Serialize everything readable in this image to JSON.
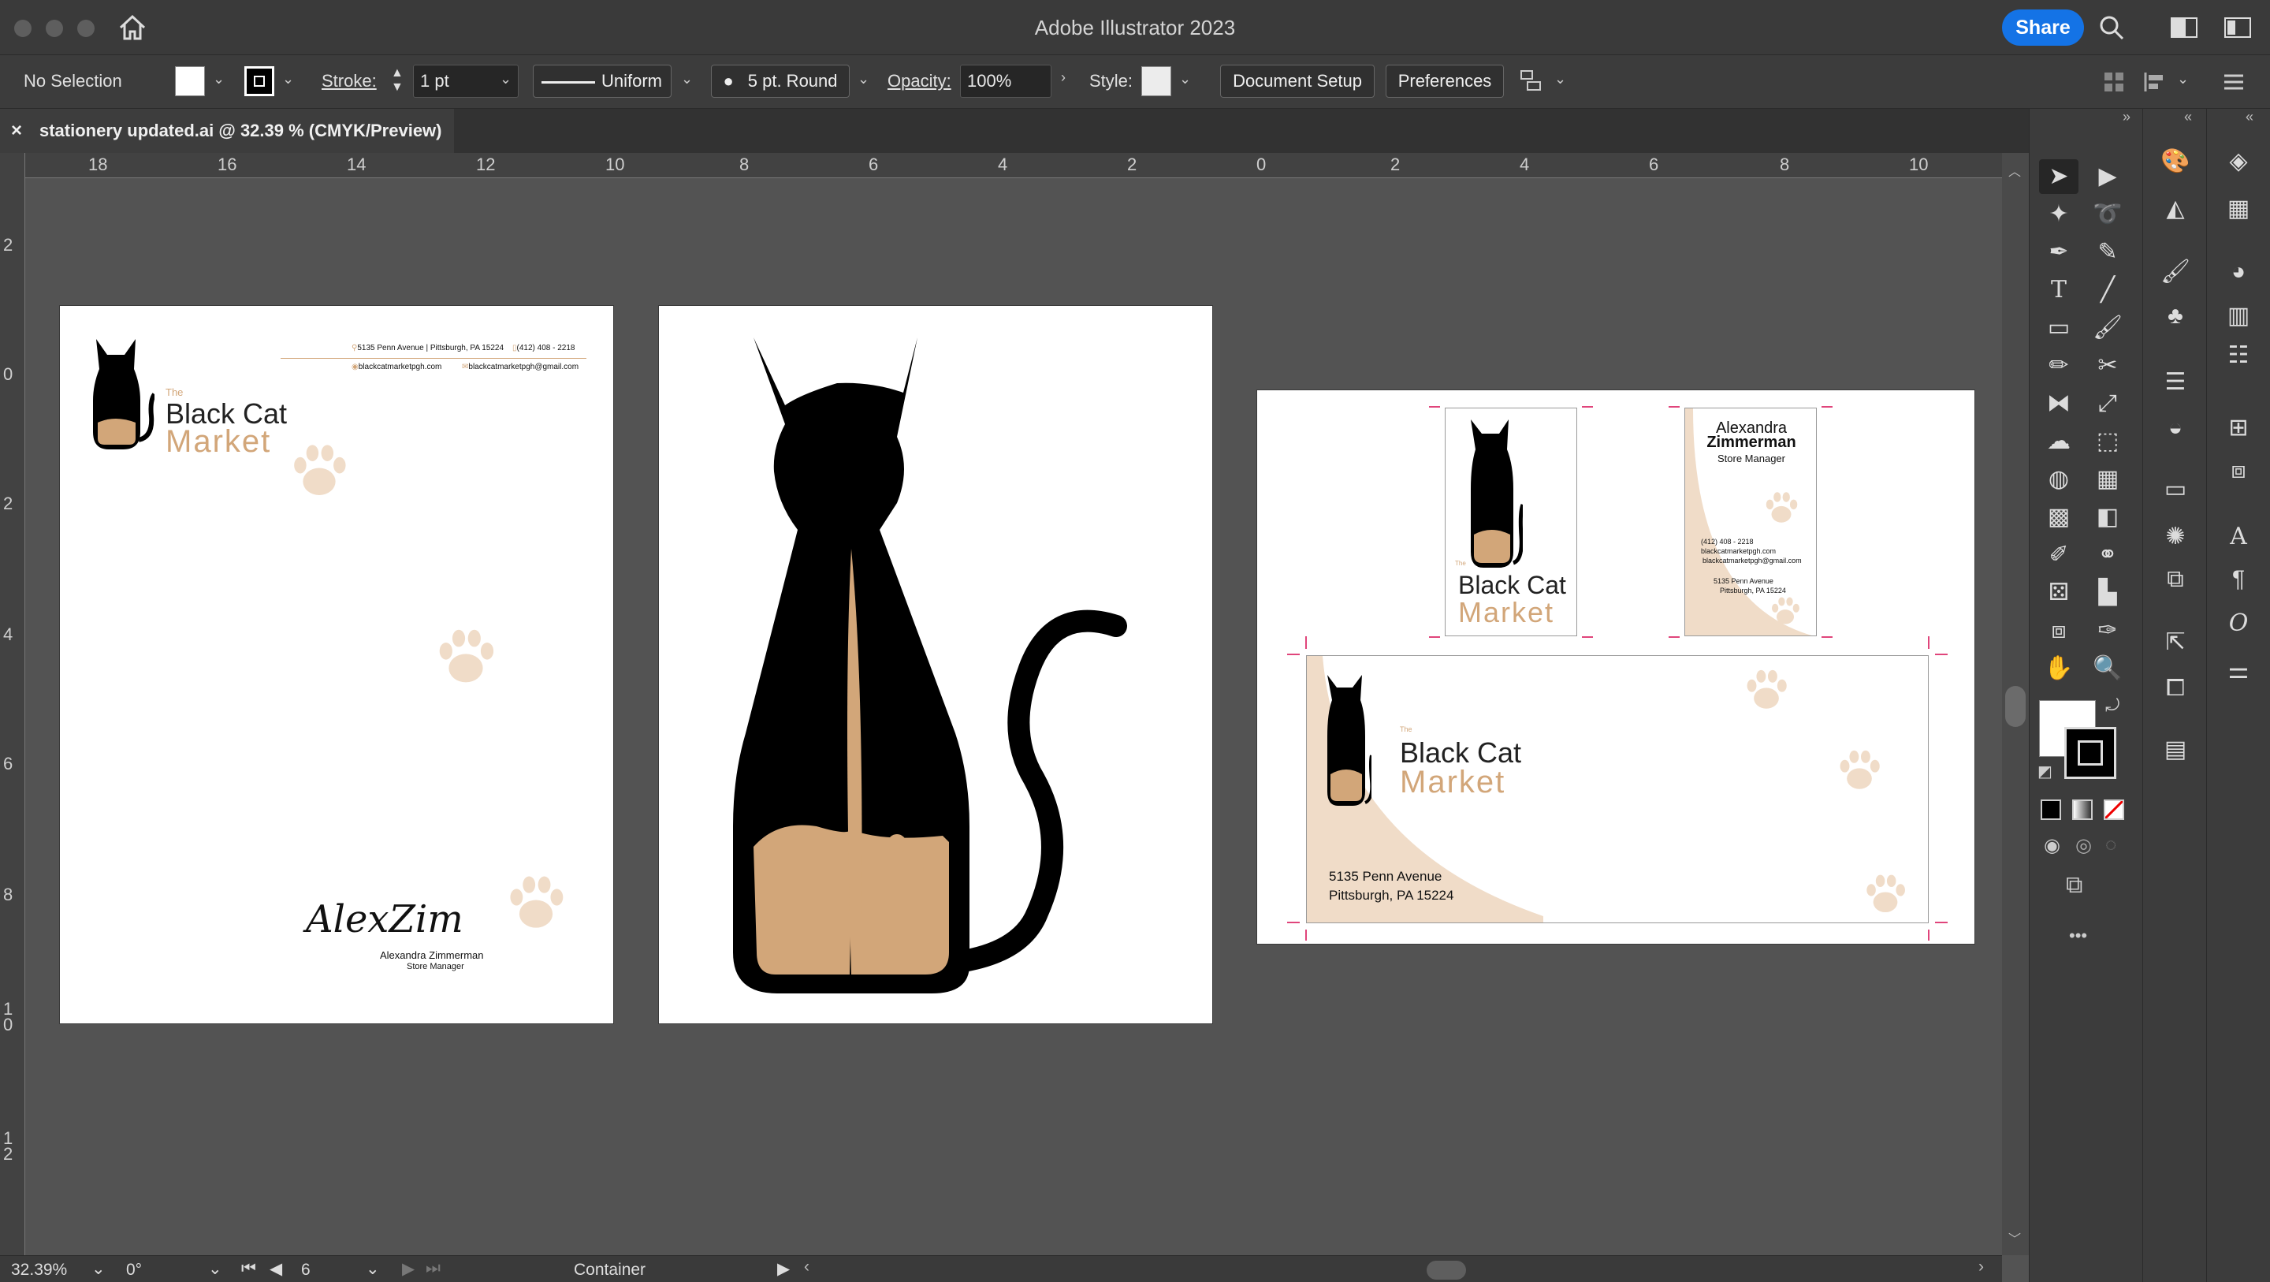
{
  "app_title": "Adobe Illustrator 2023",
  "share_label": "Share",
  "control": {
    "selection": "No Selection",
    "stroke_label": "Stroke:",
    "stroke_value": "1 pt",
    "profile": "Uniform",
    "brush": "5 pt. Round",
    "opacity_label": "Opacity:",
    "opacity_value": "100%",
    "style_label": "Style:",
    "document_setup": "Document Setup",
    "preferences": "Preferences"
  },
  "tab": {
    "close": "×",
    "title": "stationery updated.ai @ 32.39 % (CMYK/Preview)"
  },
  "ruler": {
    "h": [
      "18",
      "16",
      "14",
      "12",
      "10",
      "8",
      "6",
      "4",
      "2",
      "0",
      "2",
      "4",
      "6",
      "8",
      "10"
    ],
    "v": [
      "2",
      "0",
      "2",
      "4",
      "6",
      "8",
      "1\n0",
      "1\n2"
    ]
  },
  "letterhead": {
    "the": "The",
    "brand1": "Black Cat",
    "brand2": "Market",
    "address": "5135 Penn Avenue | Pittsburgh, PA 15224",
    "phone": "(412) 408 - 2218",
    "web": "blackcatmarketpgh.com",
    "email": "blackcatmarketpgh@gmail.com",
    "signature": "AlexZim",
    "sig_name": "Alexandra Zimmerman",
    "sig_title": "Store Manager"
  },
  "card": {
    "the": "The",
    "brand1": "Black Cat",
    "brand2": "Market",
    "first": "Alexandra",
    "last": "Zimmerman",
    "title": "Store Manager",
    "phone": "(412) 408 - 2218",
    "web": "blackcatmarketpgh.com",
    "email": "blackcatmarketpgh@gmail.com",
    "addr1": "5135 Penn Avenue",
    "addr2": "Pittsburgh, PA 15224"
  },
  "envelope": {
    "the": "The",
    "brand1": "Black Cat",
    "brand2": "Market",
    "addr1": "5135 Penn Avenue",
    "addr2": "Pittsburgh, PA 15224"
  },
  "status": {
    "zoom": "32.39%",
    "rotation": "0°",
    "artboard": "6",
    "label": "Container"
  },
  "colors": {
    "accent": "#1473e6",
    "tan": "#d2a679",
    "paw": "#f0dcc8"
  },
  "more": "•••"
}
